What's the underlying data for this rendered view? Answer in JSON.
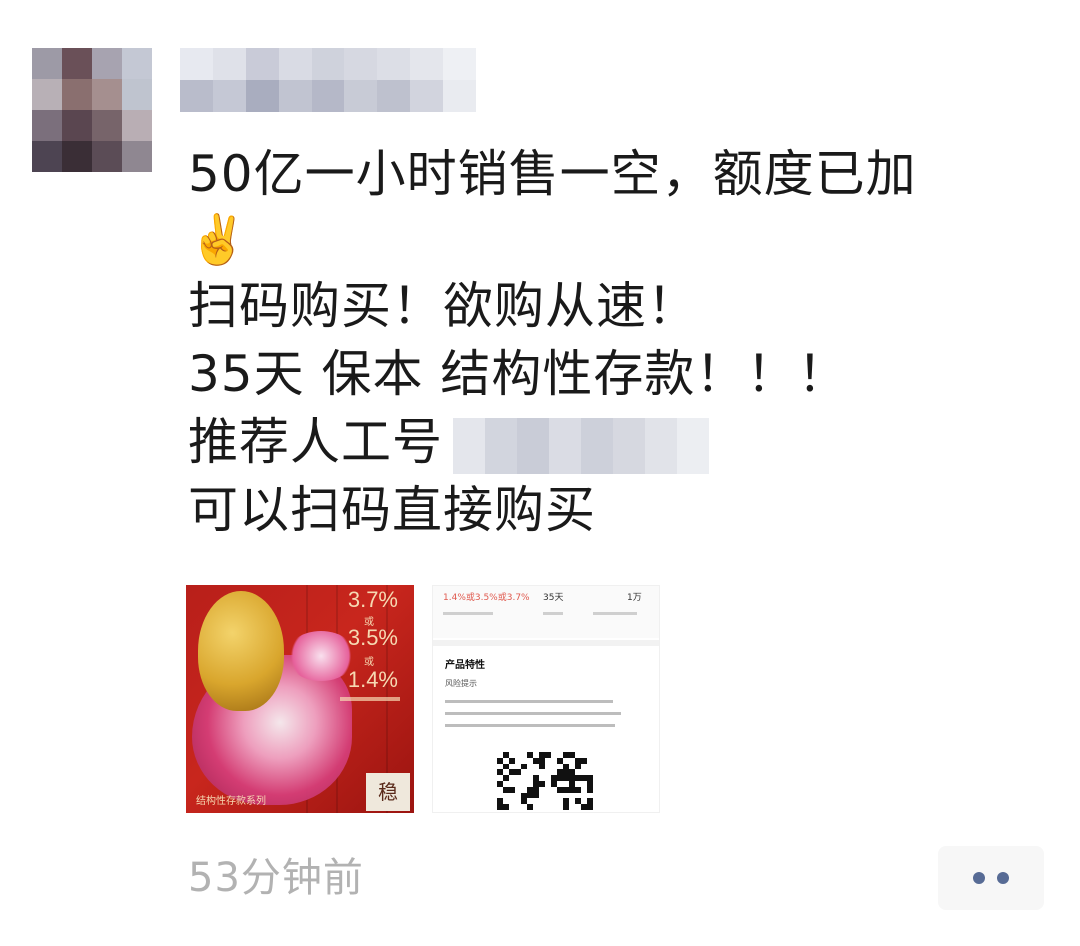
{
  "post": {
    "text_lines": [
      "50亿一小时销售一空，额度已加",
      "✌️",
      "扫码购买！欲购从速！",
      "35天 保本 结构性存款！！！",
      "推荐人工号",
      "可以扫码直接购买"
    ],
    "timestamp": "53分钟前"
  },
  "images": [
    {
      "rates": [
        "3.7%",
        "3.5%",
        "1.4%"
      ],
      "rate_separator": "或",
      "caption": "结构性存款系列",
      "stamp": "稳"
    },
    {
      "rate_range": "1.4%或3.5%或3.7%",
      "term": "35天",
      "min_amount": "1万",
      "section_title": "产品特性",
      "risk_label": "风险提示"
    }
  ],
  "colors": {
    "text": "#1a1a1a",
    "timestamp": "#b2b2b2",
    "more_dots": "#576b95",
    "poster_red": "#c8261d"
  },
  "icons": {
    "more": "more-dots-icon",
    "emoji": "victory-hand-emoji"
  }
}
